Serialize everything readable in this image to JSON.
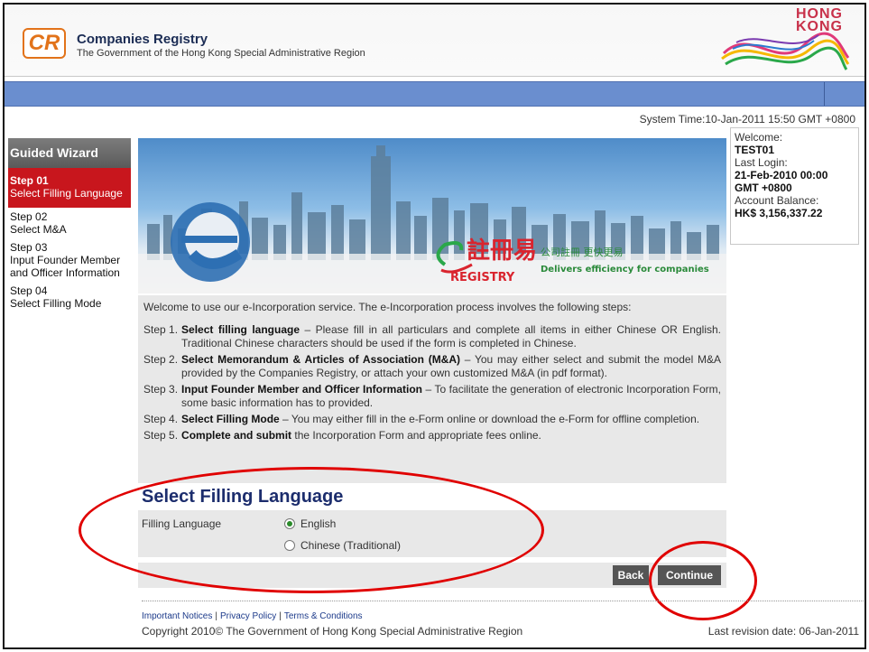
{
  "header": {
    "logo_text": "CR",
    "org_name": "Companies Registry",
    "org_subtitle": "The Government of the Hong Kong Special Administrative Region",
    "hk_logo_line1": "HONG",
    "hk_logo_line2": "KONG"
  },
  "system_time": "System Time:10-Jan-2011 15:50 GMT +0800",
  "sidebar": {
    "title": "Guided Wizard",
    "steps": [
      {
        "num": "Step 01",
        "label": "Select Filling Language",
        "active": true
      },
      {
        "num": "Step 02",
        "label": "Select M&A",
        "active": false
      },
      {
        "num": "Step 03",
        "label": "Input Founder Member and Officer Information",
        "active": false
      },
      {
        "num": "Step 04",
        "label": "Select Filling Mode",
        "active": false
      }
    ]
  },
  "banner": {
    "cn_title": "註冊易",
    "cn_slogan": "公司註冊 更快更易",
    "registry_word": "REGISTRY",
    "tagline": "Delivers efficiency for companies"
  },
  "welcome": {
    "label": "Welcome:",
    "user": "TEST01",
    "last_login_label": "Last Login:",
    "last_login": "21-Feb-2010 00:00",
    "tz": "GMT +0800",
    "balance_label": "Account Balance:",
    "balance": "HK$ 3,156,337.22"
  },
  "intro": {
    "lead": "Welcome to use our e-Incorporation service. The e-Incorporation process involves the following steps:",
    "steps": [
      {
        "label": "Step 1.",
        "bold": "Select filling language",
        "text": " – Please fill in all particulars and complete all items in either Chinese OR English. Traditional Chinese characters should be used if the form is completed in Chinese."
      },
      {
        "label": "Step 2.",
        "bold": "Select Memorandum & Articles of Association (M&A)",
        "text": " – You may either select and submit the model M&A provided by the Companies Registry, or attach your own customized M&A (in pdf format)."
      },
      {
        "label": "Step 3.",
        "bold": "Input Founder Member and Officer Information",
        "text": " – To facilitate the generation of electronic Incorporation Form, some basic information has to provided."
      },
      {
        "label": "Step 4.",
        "bold": "Select Filling Mode",
        "text": " – You may either fill in the e-Form online or download the e-Form for offline completion."
      },
      {
        "label": "Step 5.",
        "bold": "Complete and submit",
        "text": " the Incorporation Form and appropriate fees online."
      }
    ]
  },
  "language": {
    "section_title": "Select Filling Language",
    "field_label": "Filling Language",
    "options": [
      {
        "label": "English",
        "checked": true
      },
      {
        "label": "Chinese (Traditional)",
        "checked": false
      }
    ]
  },
  "buttons": {
    "back": "Back",
    "continue": "Continue"
  },
  "footer": {
    "links": [
      "Important Notices",
      "Privacy Policy",
      "Terms & Conditions"
    ],
    "copyright": "Copyright 2010© The Government of Hong Kong Special Administrative Region",
    "revision": "Last revision date: 06-Jan-2011"
  },
  "colors": {
    "accent_red": "#c8161d",
    "nav_blue": "#6a8ecf",
    "title_navy": "#1c2d6d",
    "annotation_red": "#e00000"
  }
}
